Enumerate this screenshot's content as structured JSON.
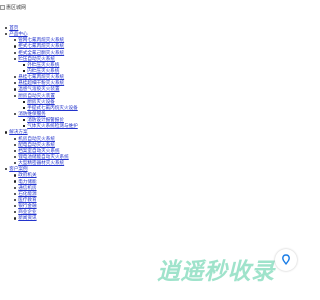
{
  "header": {
    "logo_alt": "惠区城网"
  },
  "nav": [
    {
      "label": "首页",
      "level": 0
    },
    {
      "label": "产品中心",
      "level": 0
    },
    {
      "label": "管网七氟丙烷灭火系统",
      "level": 1
    },
    {
      "label": "柜式七氟丙烷灭火系统",
      "level": 1
    },
    {
      "label": "柜式全氟己酮灭火系统",
      "level": 1
    },
    {
      "label": "贮压自动灭火系统",
      "level": 1
    },
    {
      "label": "外贮压灭火系统",
      "level": 2
    },
    {
      "label": "内贮压灭火系统",
      "level": 2
    },
    {
      "label": "悬挂七氟丙烷灭火系统",
      "level": 1
    },
    {
      "label": "悬挂超细干粉灭火系统",
      "level": 1
    },
    {
      "label": "温感气溶胶灭火装置",
      "level": 1
    },
    {
      "label": "厨房自动灭火装置",
      "level": 1
    },
    {
      "label": "厨房灭火设备",
      "level": 2
    },
    {
      "label": "手提式七氟丙烷灭火设备",
      "level": 2
    },
    {
      "label": "消防维保服务",
      "level": 1
    },
    {
      "label": "消防设计报警报价",
      "level": 2
    },
    {
      "label": "气体灭火系统检测与维护",
      "level": 2
    },
    {
      "label": "解决方案",
      "level": 0
    },
    {
      "label": "机房自动灭火系统",
      "level": 1
    },
    {
      "label": "配电自动灭火系统",
      "level": 1
    },
    {
      "label": "档案室自动灭火系统",
      "level": 1
    },
    {
      "label": "锂电池储能自动灭火系统",
      "level": 1
    },
    {
      "label": "大型精密器材灭火系统",
      "level": 1
    },
    {
      "label": "客户案例",
      "level": 0
    },
    {
      "label": "政府机关",
      "level": 1
    },
    {
      "label": "电力储能",
      "level": 1
    },
    {
      "label": "通信机房",
      "level": 1
    },
    {
      "label": "石化能源",
      "level": 1
    },
    {
      "label": "医疗教育",
      "level": 1
    },
    {
      "label": "银行金融",
      "level": 1
    },
    {
      "label": "商业企业",
      "level": 1
    },
    {
      "label": "新闻资讯",
      "level": 1
    }
  ],
  "watermark": {
    "text": "逍遥秒收录",
    "color": "#9fe3cb",
    "badge_icon": "download-icon",
    "badge_color": "#1a7de6"
  }
}
